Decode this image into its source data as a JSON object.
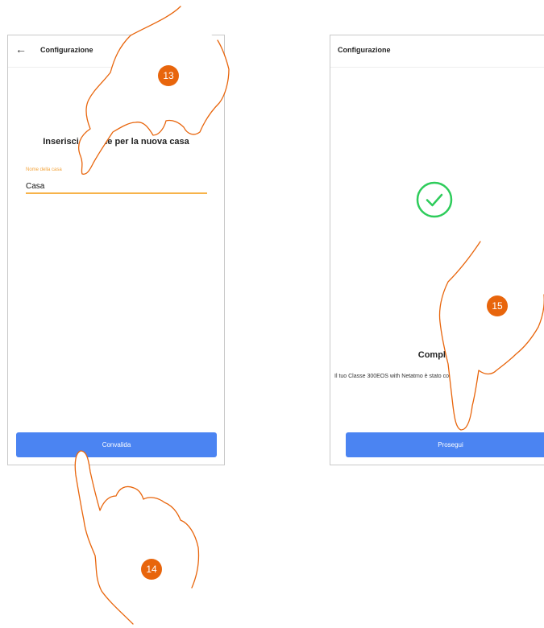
{
  "left_screen": {
    "header_title": "Configurazione",
    "heading": "Inserisci il nome per la nuova casa",
    "field_label": "Nome della casa",
    "field_value": "Casa",
    "button_label": "Convalida"
  },
  "right_screen": {
    "header_title": "Configurazione",
    "complete_title": "Completato",
    "complete_message": "Il tuo Classe 300EOS with Netatmo è stato configurato.",
    "button_label": "Prosegui"
  },
  "steps": {
    "step_13": "13",
    "step_14": "14",
    "step_15": "15"
  },
  "colors": {
    "accent_button": "#4b84f2",
    "input_underline": "#f7b34a",
    "success_check": "#2ecc5b",
    "hand_outline": "#e8650c"
  }
}
